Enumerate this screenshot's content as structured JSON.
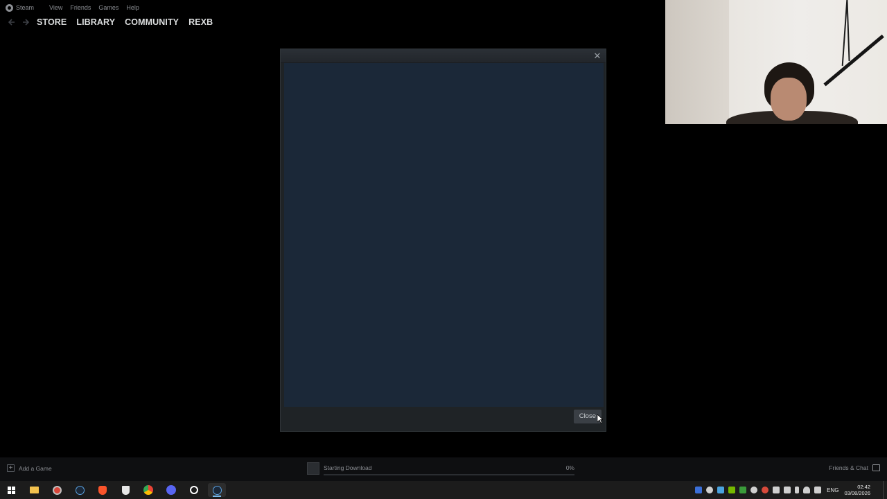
{
  "menubar": {
    "items": [
      "Steam",
      "View",
      "Friends",
      "Games",
      "Help"
    ]
  },
  "nav": {
    "links": [
      "STORE",
      "LIBRARY",
      "COMMUNITY",
      "REXB"
    ]
  },
  "dialog": {
    "close_label": "Close"
  },
  "bottombar": {
    "add_game": "Add a Game",
    "download_status": "Starting Download",
    "download_percent": "0%",
    "download_progress": 0,
    "friends_chat": "Friends & Chat"
  },
  "taskbar": {
    "apps": [
      {
        "name": "windows-start-icon",
        "color": "#ffffff"
      },
      {
        "name": "file-explorer-icon",
        "color": "#f2c14e"
      },
      {
        "name": "app-icon",
        "color": "#d9463a"
      },
      {
        "name": "steam-icon",
        "color": "#5aa1e0"
      },
      {
        "name": "brave-icon",
        "color": "#fb542b"
      },
      {
        "name": "epic-games-icon",
        "color": "#e6e6e6"
      },
      {
        "name": "chrome-icon",
        "color": "#34a853"
      },
      {
        "name": "discord-icon",
        "color": "#5865f2"
      },
      {
        "name": "steelseries-icon",
        "color": "#ffffff"
      },
      {
        "name": "steam-active-icon",
        "color": "#5aa1e0"
      }
    ],
    "language": "ENG",
    "time": "02:42",
    "date": "03/08/2026"
  },
  "colors": {
    "accent": "#1a9fff",
    "dialog_content": "#1b2838",
    "background": "#000000"
  }
}
